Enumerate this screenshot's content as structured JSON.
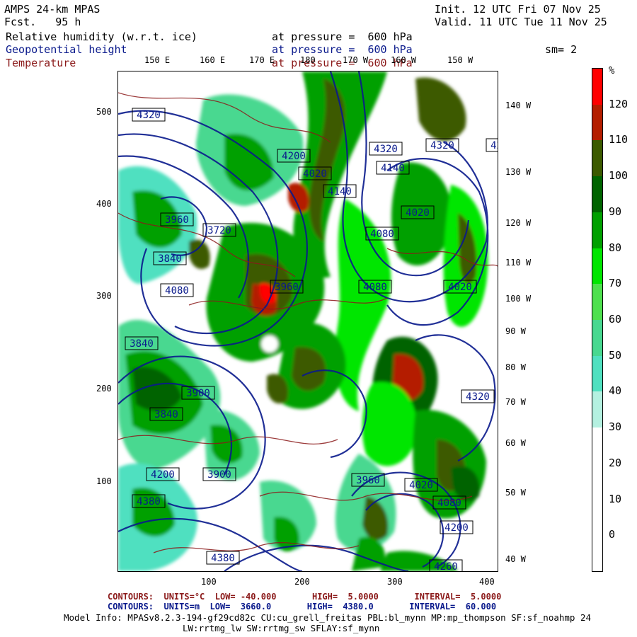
{
  "header": {
    "model": "AMPS 24-km MPAS",
    "forecast": "Fcst.   95 h",
    "init": "Init. 12 UTC Fri 07 Nov 25",
    "valid": "Valid. 11 UTC Tue 11 Nov 25",
    "smoothing": "sm= 2"
  },
  "fields": [
    {
      "name": "Relative humidity (w.r.t. ice)",
      "level": "at pressure =  600 hPa",
      "color": "#000000"
    },
    {
      "name": "Geopotential height",
      "level": "at pressure =  600 hPa",
      "color": "#0a1a8c"
    },
    {
      "name": "Temperature",
      "level": "at pressure =  600 hPa",
      "color": "#8b1a1a"
    }
  ],
  "top_lon_labels": [
    "150 E",
    "160 E",
    "170 E",
    "180",
    "170 W",
    "160 W",
    "150 W"
  ],
  "right_lon_labels": [
    "140 W",
    "130 W",
    "120 W",
    "110 W",
    "100 W",
    "90 W",
    "80 W",
    "70 W",
    "60 W",
    "50 W",
    "40 W"
  ],
  "x_grid_ticks": [
    "100",
    "200",
    "300",
    "400"
  ],
  "y_grid_ticks": [
    "500",
    "400",
    "300",
    "200",
    "100"
  ],
  "colorbar": {
    "unit": "%",
    "ticks": [
      "120",
      "110",
      "100",
      "90",
      "80",
      "70",
      "60",
      "50",
      "40",
      "30",
      "20",
      "10",
      "0"
    ],
    "segments": [
      {
        "from": 120,
        "to": 130,
        "color": "#ff0000"
      },
      {
        "from": 110,
        "to": 120,
        "color": "#b41e00"
      },
      {
        "from": 100,
        "to": 110,
        "color": "#3c5a00"
      },
      {
        "from": 90,
        "to": 100,
        "color": "#006400"
      },
      {
        "from": 80,
        "to": 90,
        "color": "#00a000"
      },
      {
        "from": 70,
        "to": 80,
        "color": "#00e600"
      },
      {
        "from": 60,
        "to": 70,
        "color": "#4ee04e"
      },
      {
        "from": 50,
        "to": 60,
        "color": "#48d890"
      },
      {
        "from": 40,
        "to": 50,
        "color": "#50e0c0"
      },
      {
        "from": 30,
        "to": 40,
        "color": "#b4f0e0"
      },
      {
        "from": 20,
        "to": 30,
        "color": "#ffffff"
      },
      {
        "from": 10,
        "to": 20,
        "color": "#ffffff"
      },
      {
        "from": 0,
        "to": 10,
        "color": "#ffffff"
      },
      {
        "from": -10,
        "to": 0,
        "color": "#ffffff"
      }
    ]
  },
  "height_labels": [
    "4320",
    "4200",
    "4320",
    "4320",
    "4140",
    "4080",
    "4200",
    "4020",
    "3960",
    "3720",
    "4140",
    "4080",
    "3840",
    "4020",
    "4080",
    "4320",
    "3840",
    "3900",
    "4200",
    "4380",
    "3960",
    "4020",
    "4080",
    "4200",
    "4260",
    "4380",
    "3960",
    "4020",
    "3840",
    "3900"
  ],
  "footer": {
    "temp_contours": "CONTOURS:  UNITS=°C  LOW= -40.000       HIGH=  5.0000       INTERVAL=  5.0000",
    "height_contours": "CONTOURS:  UNITS=m  LOW=  3660.0       HIGH=  4380.0       INTERVAL=  60.000",
    "model_info_1": "Model Info: MPASv8.2.3-194-gf29cd82c CU:cu_grell_freitas PBL:bl_mynn MP:mp_thompson SF:sf_noahmp 24",
    "model_info_2": "LW:rrtmg_lw SW:rrtmg_sw SFLAY:sf_mynn"
  }
}
